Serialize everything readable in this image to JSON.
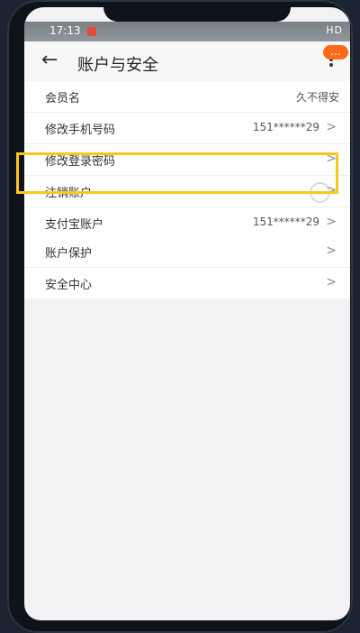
{
  "status": {
    "time": "17:13",
    "right_icons": "HD"
  },
  "header": {
    "title": "账户与安全",
    "badge": "…"
  },
  "groups": [
    {
      "rows": [
        {
          "label": "会员名",
          "value": "久不得安",
          "chevron": false
        },
        {
          "label": "修改手机号码",
          "value": "151******29",
          "chevron": true
        },
        {
          "label": "修改登录密码",
          "value": "",
          "chevron": true
        },
        {
          "label": "注销账户",
          "value": "",
          "chevron": true
        },
        {
          "label": "支付宝账户",
          "value": "151******29",
          "chevron": true
        }
      ]
    },
    {
      "rows": [
        {
          "label": "账户保护",
          "value": "",
          "chevron": true
        },
        {
          "label": "安全中心",
          "value": "",
          "chevron": true
        }
      ]
    }
  ],
  "colors": {
    "accent": "#ffc61a",
    "badge": "#ff6a1a"
  }
}
